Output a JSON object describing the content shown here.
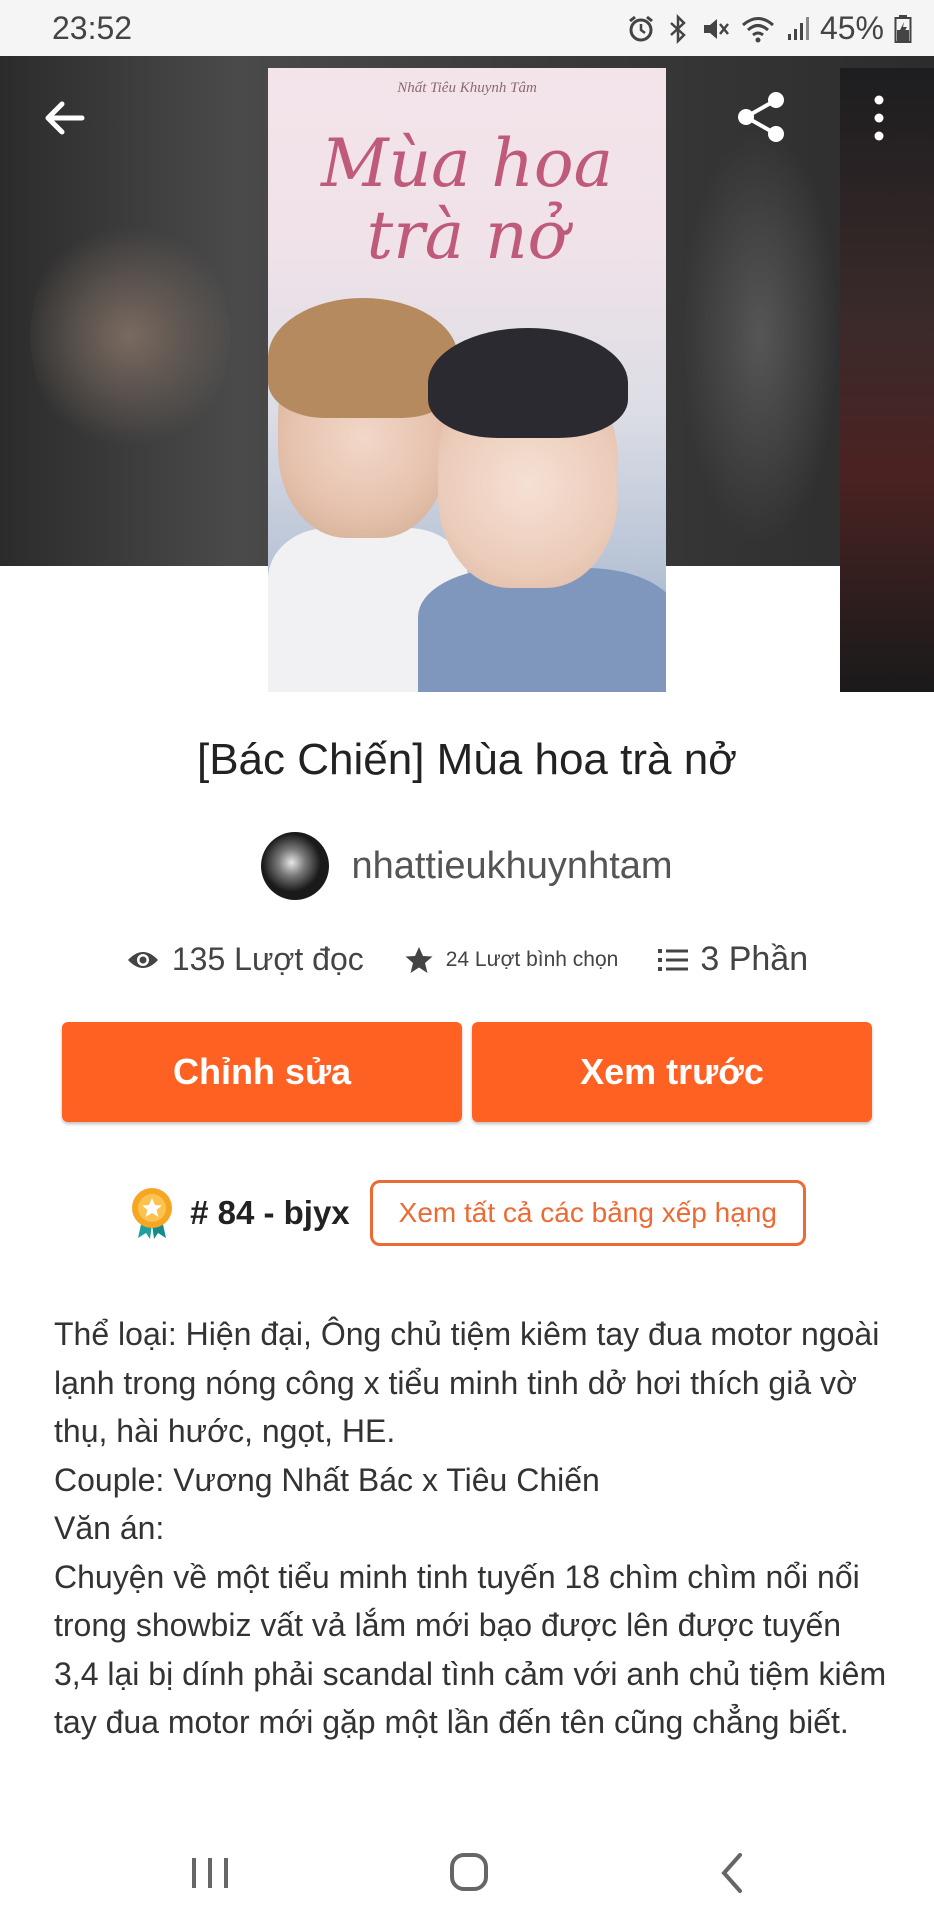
{
  "status_bar": {
    "time": "23:52",
    "battery": "45%",
    "icons": [
      "alarm-icon",
      "bluetooth-icon",
      "mute-icon",
      "wifi-icon",
      "signal-icon",
      "battery-icon"
    ]
  },
  "header": {
    "back_icon": "arrow-left-icon",
    "share_icon": "share-icon",
    "more_icon": "more-vertical-icon"
  },
  "cover": {
    "author": "Nhất Tiêu Khuynh Tâm",
    "title_line1": "Mùa hoa",
    "title_line2": "trà nở"
  },
  "story": {
    "title": "[Bác Chiến] Mùa hoa trà nở",
    "author": "nhattieukhuynhtam"
  },
  "stats": {
    "views": "135 Lượt đọc",
    "votes": "24 Lượt bình chọn",
    "parts": "3 Phần"
  },
  "actions": {
    "edit": "Chỉnh sửa",
    "preview": "Xem trước"
  },
  "ranking": {
    "rank": "# 84 - bjyx",
    "see_all": "Xem tất cả các bảng xếp hạng"
  },
  "description": [
    "Thể loại: Hiện đại, Ông chủ tiệm kiêm tay đua motor ngoài lạnh trong nóng công x tiểu minh tinh dở hơi thích giả vờ thụ, hài hước, ngọt, HE.",
    "Couple: Vương Nhất Bác x Tiêu Chiến",
    "Văn án:",
    "Chuyện về một tiểu minh tinh tuyến 18 chìm chìm nổi nổi trong showbiz vất vả lắm mới bạo được lên được tuyến 3,4 lại bị dính phải scandal tình cảm với anh chủ tiệm kiêm tay đua motor mới gặp một lần đến tên cũng chẳng biết."
  ],
  "colors": {
    "accent": "#ff6122",
    "rank_border": "#ec6a33"
  }
}
